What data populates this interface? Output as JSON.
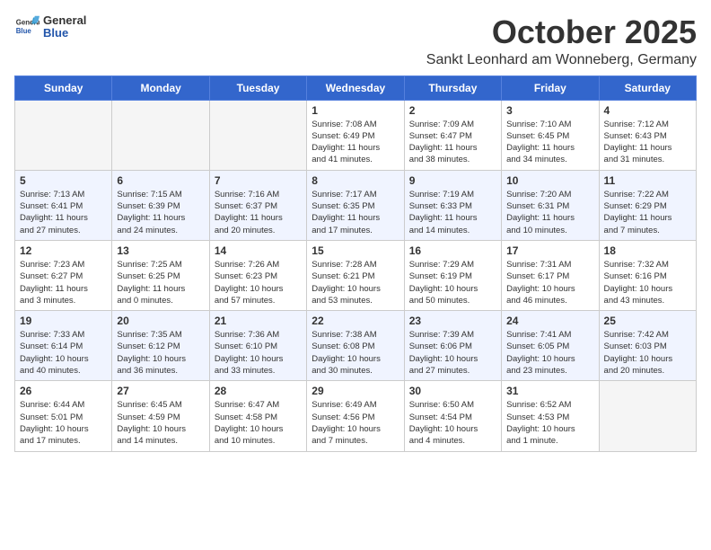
{
  "header": {
    "logo_general": "General",
    "logo_blue": "Blue",
    "month": "October 2025",
    "location": "Sankt Leonhard am Wonneberg, Germany"
  },
  "days_of_week": [
    "Sunday",
    "Monday",
    "Tuesday",
    "Wednesday",
    "Thursday",
    "Friday",
    "Saturday"
  ],
  "weeks": [
    [
      {
        "day": "",
        "info": ""
      },
      {
        "day": "",
        "info": ""
      },
      {
        "day": "",
        "info": ""
      },
      {
        "day": "1",
        "info": "Sunrise: 7:08 AM\nSunset: 6:49 PM\nDaylight: 11 hours\nand 41 minutes."
      },
      {
        "day": "2",
        "info": "Sunrise: 7:09 AM\nSunset: 6:47 PM\nDaylight: 11 hours\nand 38 minutes."
      },
      {
        "day": "3",
        "info": "Sunrise: 7:10 AM\nSunset: 6:45 PM\nDaylight: 11 hours\nand 34 minutes."
      },
      {
        "day": "4",
        "info": "Sunrise: 7:12 AM\nSunset: 6:43 PM\nDaylight: 11 hours\nand 31 minutes."
      }
    ],
    [
      {
        "day": "5",
        "info": "Sunrise: 7:13 AM\nSunset: 6:41 PM\nDaylight: 11 hours\nand 27 minutes."
      },
      {
        "day": "6",
        "info": "Sunrise: 7:15 AM\nSunset: 6:39 PM\nDaylight: 11 hours\nand 24 minutes."
      },
      {
        "day": "7",
        "info": "Sunrise: 7:16 AM\nSunset: 6:37 PM\nDaylight: 11 hours\nand 20 minutes."
      },
      {
        "day": "8",
        "info": "Sunrise: 7:17 AM\nSunset: 6:35 PM\nDaylight: 11 hours\nand 17 minutes."
      },
      {
        "day": "9",
        "info": "Sunrise: 7:19 AM\nSunset: 6:33 PM\nDaylight: 11 hours\nand 14 minutes."
      },
      {
        "day": "10",
        "info": "Sunrise: 7:20 AM\nSunset: 6:31 PM\nDaylight: 11 hours\nand 10 minutes."
      },
      {
        "day": "11",
        "info": "Sunrise: 7:22 AM\nSunset: 6:29 PM\nDaylight: 11 hours\nand 7 minutes."
      }
    ],
    [
      {
        "day": "12",
        "info": "Sunrise: 7:23 AM\nSunset: 6:27 PM\nDaylight: 11 hours\nand 3 minutes."
      },
      {
        "day": "13",
        "info": "Sunrise: 7:25 AM\nSunset: 6:25 PM\nDaylight: 11 hours\nand 0 minutes."
      },
      {
        "day": "14",
        "info": "Sunrise: 7:26 AM\nSunset: 6:23 PM\nDaylight: 10 hours\nand 57 minutes."
      },
      {
        "day": "15",
        "info": "Sunrise: 7:28 AM\nSunset: 6:21 PM\nDaylight: 10 hours\nand 53 minutes."
      },
      {
        "day": "16",
        "info": "Sunrise: 7:29 AM\nSunset: 6:19 PM\nDaylight: 10 hours\nand 50 minutes."
      },
      {
        "day": "17",
        "info": "Sunrise: 7:31 AM\nSunset: 6:17 PM\nDaylight: 10 hours\nand 46 minutes."
      },
      {
        "day": "18",
        "info": "Sunrise: 7:32 AM\nSunset: 6:16 PM\nDaylight: 10 hours\nand 43 minutes."
      }
    ],
    [
      {
        "day": "19",
        "info": "Sunrise: 7:33 AM\nSunset: 6:14 PM\nDaylight: 10 hours\nand 40 minutes."
      },
      {
        "day": "20",
        "info": "Sunrise: 7:35 AM\nSunset: 6:12 PM\nDaylight: 10 hours\nand 36 minutes."
      },
      {
        "day": "21",
        "info": "Sunrise: 7:36 AM\nSunset: 6:10 PM\nDaylight: 10 hours\nand 33 minutes."
      },
      {
        "day": "22",
        "info": "Sunrise: 7:38 AM\nSunset: 6:08 PM\nDaylight: 10 hours\nand 30 minutes."
      },
      {
        "day": "23",
        "info": "Sunrise: 7:39 AM\nSunset: 6:06 PM\nDaylight: 10 hours\nand 27 minutes."
      },
      {
        "day": "24",
        "info": "Sunrise: 7:41 AM\nSunset: 6:05 PM\nDaylight: 10 hours\nand 23 minutes."
      },
      {
        "day": "25",
        "info": "Sunrise: 7:42 AM\nSunset: 6:03 PM\nDaylight: 10 hours\nand 20 minutes."
      }
    ],
    [
      {
        "day": "26",
        "info": "Sunrise: 6:44 AM\nSunset: 5:01 PM\nDaylight: 10 hours\nand 17 minutes."
      },
      {
        "day": "27",
        "info": "Sunrise: 6:45 AM\nSunset: 4:59 PM\nDaylight: 10 hours\nand 14 minutes."
      },
      {
        "day": "28",
        "info": "Sunrise: 6:47 AM\nSunset: 4:58 PM\nDaylight: 10 hours\nand 10 minutes."
      },
      {
        "day": "29",
        "info": "Sunrise: 6:49 AM\nSunset: 4:56 PM\nDaylight: 10 hours\nand 7 minutes."
      },
      {
        "day": "30",
        "info": "Sunrise: 6:50 AM\nSunset: 4:54 PM\nDaylight: 10 hours\nand 4 minutes."
      },
      {
        "day": "31",
        "info": "Sunrise: 6:52 AM\nSunset: 4:53 PM\nDaylight: 10 hours\nand 1 minute."
      },
      {
        "day": "",
        "info": ""
      }
    ]
  ]
}
